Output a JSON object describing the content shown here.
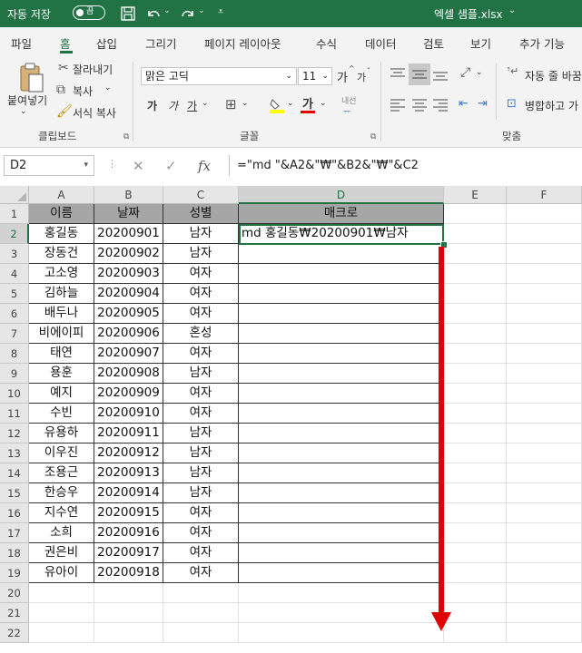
{
  "titlebar": {
    "autosave_label": "자동 저장",
    "autosave_state": "끔",
    "filename": "엑셀 샘플.xlsx",
    "filename_chevron": "⌄",
    "icons": [
      "save-icon",
      "undo-icon",
      "redo-icon",
      "customize-qat-icon"
    ]
  },
  "tabs": [
    "파일",
    "홈",
    "삽입",
    "그리기",
    "페이지 레이아웃",
    "수식",
    "데이터",
    "검토",
    "보기",
    "추가 기능"
  ],
  "active_tab": "홈",
  "ribbon": {
    "clipboard": {
      "paste": "붙여넣기",
      "cut": "잘라내기",
      "copy": "복사",
      "format_painter": "서식 복사",
      "group_label": "클립보드"
    },
    "font": {
      "font_name": "맑은 고딕",
      "font_size": "11",
      "bold": "가",
      "italic": "가",
      "underline": "가",
      "strike_hint": "내선",
      "group_label": "글꼴",
      "grow": "가",
      "shrink": "가"
    },
    "alignment": {
      "wrap_text": "자동 줄 바꿈",
      "merge_center": "병합하고 가",
      "group_label": "맞춤"
    }
  },
  "formula_bar": {
    "name_box": "D2",
    "fx": "fx",
    "formula": "=\"md \"&A2&\"₩\"&B2&\"₩\"&C2"
  },
  "sheet": {
    "columns": [
      "A",
      "B",
      "C",
      "D",
      "E",
      "F"
    ],
    "header_row": [
      "이름",
      "날짜",
      "성별",
      "매크로"
    ],
    "rows": [
      [
        "홍길동",
        "20200901",
        "남자",
        "md 홍길동₩20200901₩남자"
      ],
      [
        "장동건",
        "20200902",
        "남자",
        ""
      ],
      [
        "고소영",
        "20200903",
        "여자",
        ""
      ],
      [
        "김하늘",
        "20200904",
        "여자",
        ""
      ],
      [
        "배두나",
        "20200905",
        "여자",
        ""
      ],
      [
        "비에이피",
        "20200906",
        "혼성",
        ""
      ],
      [
        "태연",
        "20200907",
        "여자",
        ""
      ],
      [
        "용훈",
        "20200908",
        "남자",
        ""
      ],
      [
        "예지",
        "20200909",
        "여자",
        ""
      ],
      [
        "수빈",
        "20200910",
        "여자",
        ""
      ],
      [
        "유용하",
        "20200911",
        "남자",
        ""
      ],
      [
        "이우진",
        "20200912",
        "남자",
        ""
      ],
      [
        "조용근",
        "20200913",
        "남자",
        ""
      ],
      [
        "한승우",
        "20200914",
        "남자",
        ""
      ],
      [
        "지수연",
        "20200915",
        "여자",
        ""
      ],
      [
        "소희",
        "20200916",
        "여자",
        ""
      ],
      [
        "권은비",
        "20200917",
        "여자",
        ""
      ],
      [
        "유아이",
        "20200918",
        "여자",
        ""
      ]
    ],
    "row_numbers": [
      "1",
      "2",
      "3",
      "4",
      "5",
      "6",
      "7",
      "8",
      "9",
      "10",
      "11",
      "12",
      "13",
      "14",
      "15",
      "16",
      "17",
      "18",
      "19",
      "20",
      "21",
      "22"
    ],
    "active_cell": "D2",
    "annotation": "red-down-arrow"
  },
  "colors": {
    "excel_green": "#217346",
    "header_fill": "#a6a6a6",
    "annotation_red": "#e00000"
  }
}
